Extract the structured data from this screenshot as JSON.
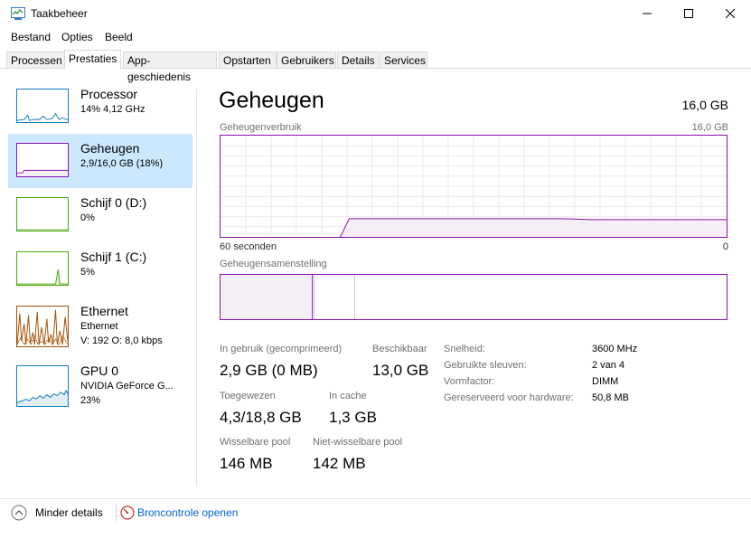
{
  "window": {
    "title": "Taakbeheer"
  },
  "menu": [
    "Bestand",
    "Opties",
    "Beeld"
  ],
  "tabs": [
    "Processen",
    "Prestaties",
    "App-geschiedenis",
    "Opstarten",
    "Gebruikers",
    "Details",
    "Services"
  ],
  "active_tab": "Prestaties",
  "sidebar": [
    {
      "title": "Processor",
      "line1": "14%  4,12 GHz",
      "line2": "",
      "line3": ""
    },
    {
      "title": "Geheugen",
      "line1": "2,9/16,0 GB (18%)",
      "line2": "",
      "line3": ""
    },
    {
      "title": "Schijf 0 (D:)",
      "line1": "0%",
      "line2": "",
      "line3": ""
    },
    {
      "title": "Schijf 1 (C:)",
      "line1": "5%",
      "line2": "",
      "line3": ""
    },
    {
      "title": "Ethernet",
      "line1": "Ethernet",
      "line2": "V: 192  O: 8,0 kbps",
      "line3": ""
    },
    {
      "title": "GPU 0",
      "line1": "NVIDIA GeForce G...",
      "line2": "23%",
      "line3": ""
    }
  ],
  "main": {
    "title": "Geheugen",
    "total": "16,0 GB",
    "usage_label": "Geheugenverbruik",
    "usage_max": "16,0 GB",
    "time_left": "60 seconden",
    "time_right": "0",
    "composition_label": "Geheugensamenstelling",
    "usage_fraction": 0.18,
    "stats": {
      "in_use_label": "In gebruik (gecomprimeerd)",
      "in_use_value": "2,9 GB (0 MB)",
      "available_label": "Beschikbaar",
      "available_value": "13,0 GB",
      "committed_label": "Toegewezen",
      "committed_value": "4,3/18,8 GB",
      "cached_label": "In cache",
      "cached_value": "1,3 GB",
      "paged_label": "Wisselbare pool",
      "paged_value": "146 MB",
      "nonpaged_label": "Niet-wisselbare pool",
      "nonpaged_value": "142 MB"
    },
    "details": [
      {
        "label": "Snelheid:",
        "value": "3600 MHz"
      },
      {
        "label": "Gebruikte sleuven:",
        "value": "2 van 4"
      },
      {
        "label": "Vormfactor:",
        "value": "DIMM"
      },
      {
        "label": "Gereserveerd voor hardware:",
        "value": "50,8 MB"
      }
    ]
  },
  "footer": {
    "fewer_details": "Minder details",
    "resource_monitor": "Broncontrole openen"
  },
  "colors": {
    "memory": "#8b12ae",
    "cpu": "#117dbb",
    "disk": "#4da60c",
    "ethernet": "#a74f01",
    "selected_bg": "#cce8ff",
    "link": "#0066cc"
  }
}
